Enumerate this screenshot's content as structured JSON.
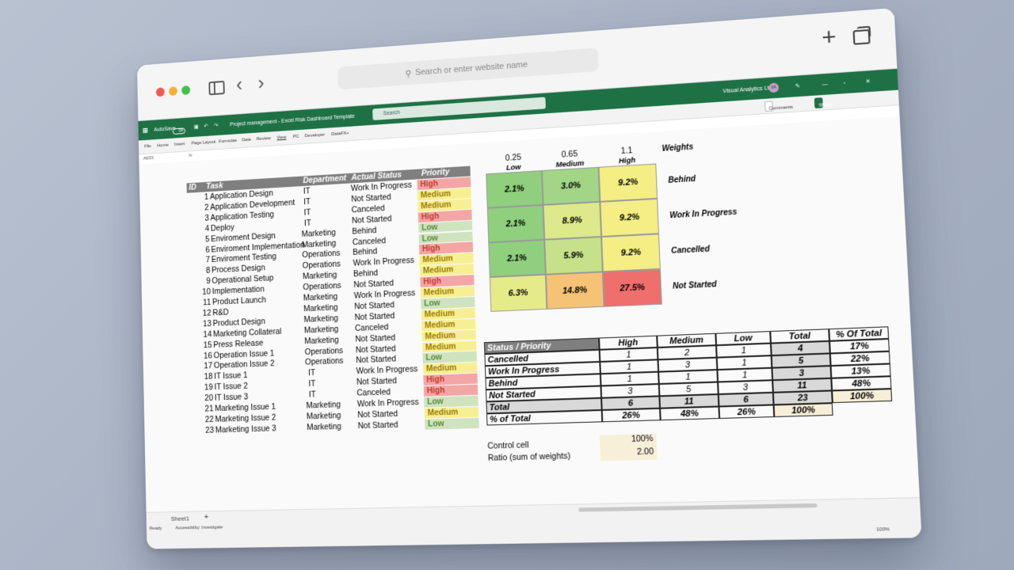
{
  "browser": {
    "search_placeholder": "Search or enter website name"
  },
  "excel": {
    "autosave_label": "AutoSave",
    "toggle_state": "Off",
    "file_title": "Project management - Excel Risk Dashboard Template",
    "search_placeholder": "Search",
    "account": "Visual Analytics Ltd",
    "account_initials": "VA",
    "ribbon_tabs": [
      "File",
      "Home",
      "Insert",
      "Page Layout",
      "Formulas",
      "Data",
      "Review",
      "View",
      "PC",
      "Developer",
      "DataFX+"
    ],
    "comments_label": "Comments",
    "share_label": "Share",
    "name_box": "AE53",
    "fx": "fx",
    "sheet_tab": "Sheet1",
    "status_ready": "Ready",
    "status_accessibility": "Accessibility: Investigate",
    "zoom": "100%"
  },
  "task_table": {
    "headers": [
      "ID",
      "Task",
      "Department",
      "Actual Status",
      "Priority"
    ],
    "rows": [
      {
        "id": "1",
        "task": "Application Design",
        "dept": "IT",
        "status": "Work In Progress",
        "priority": "High"
      },
      {
        "id": "2",
        "task": "Application Development",
        "dept": "IT",
        "status": "Not Started",
        "priority": "Medium"
      },
      {
        "id": "3",
        "task": "Application Testing",
        "dept": "IT",
        "status": "Canceled",
        "priority": "Medium"
      },
      {
        "id": "4",
        "task": "Deploy",
        "dept": "IT",
        "status": "Not Started",
        "priority": "High"
      },
      {
        "id": "5",
        "task": "Enviroment Design",
        "dept": "Marketing",
        "status": "Behind",
        "priority": "Low"
      },
      {
        "id": "6",
        "task": "Enviroment Implementation",
        "dept": "Marketing",
        "status": "Canceled",
        "priority": "Low"
      },
      {
        "id": "7",
        "task": "Enviroment Testing",
        "dept": "Operations",
        "status": "Behind",
        "priority": "High"
      },
      {
        "id": "8",
        "task": "Process Design",
        "dept": "Operations",
        "status": "Work In Progress",
        "priority": "Medium"
      },
      {
        "id": "9",
        "task": "Operational Setup",
        "dept": "Marketing",
        "status": "Behind",
        "priority": "Medium"
      },
      {
        "id": "10",
        "task": "Implementation",
        "dept": "Operations",
        "status": "Not Started",
        "priority": "High"
      },
      {
        "id": "11",
        "task": "Product Launch",
        "dept": "Marketing",
        "status": "Work In Progress",
        "priority": "Medium"
      },
      {
        "id": "12",
        "task": "R&D",
        "dept": "Marketing",
        "status": "Not Started",
        "priority": "Low"
      },
      {
        "id": "13",
        "task": "Product Design",
        "dept": "Marketing",
        "status": "Not Started",
        "priority": "Medium"
      },
      {
        "id": "14",
        "task": "Marketing Collateral",
        "dept": "Marketing",
        "status": "Canceled",
        "priority": "Medium"
      },
      {
        "id": "15",
        "task": "Press Release",
        "dept": "Marketing",
        "status": "Not Started",
        "priority": "Medium"
      },
      {
        "id": "16",
        "task": "Operation Issue 1",
        "dept": "Operations",
        "status": "Not Started",
        "priority": "Medium"
      },
      {
        "id": "17",
        "task": "Operation Issue 2",
        "dept": "Operations",
        "status": "Not Started",
        "priority": "Low"
      },
      {
        "id": "18",
        "task": "IT Issue 1",
        "dept": "IT",
        "status": "Work In Progress",
        "priority": "Medium"
      },
      {
        "id": "19",
        "task": "IT Issue 2",
        "dept": "IT",
        "status": "Not Started",
        "priority": "High"
      },
      {
        "id": "20",
        "task": "IT Issue 3",
        "dept": "IT",
        "status": "Canceled",
        "priority": "High"
      },
      {
        "id": "21",
        "task": "Marketing Issue 1",
        "dept": "Marketing",
        "status": "Work In Progress",
        "priority": "Low"
      },
      {
        "id": "22",
        "task": "Marketing Issue 2",
        "dept": "Marketing",
        "status": "Not Started",
        "priority": "Medium"
      },
      {
        "id": "23",
        "task": "Marketing Issue 3",
        "dept": "Marketing",
        "status": "Not Started",
        "priority": "Low"
      }
    ],
    "priority_colors": {
      "High": "#f4a6a6",
      "Medium": "#f7ef93",
      "Low": "#cfe3bf"
    }
  },
  "heatmap": {
    "weights": [
      "0.25",
      "0.65",
      "1.1"
    ],
    "weights_label": "Weights",
    "columns": [
      "Low",
      "Medium",
      "High"
    ],
    "rows": [
      {
        "label": "Behind",
        "cells": [
          {
            "v": "2.1%",
            "c": "#8fcf7d"
          },
          {
            "v": "3.0%",
            "c": "#a2d586"
          },
          {
            "v": "9.2%",
            "c": "#f4ee84"
          }
        ]
      },
      {
        "label": "Work In Progress",
        "cells": [
          {
            "v": "2.1%",
            "c": "#8fcf7d"
          },
          {
            "v": "8.9%",
            "c": "#dde98a"
          },
          {
            "v": "9.2%",
            "c": "#f4ee84"
          }
        ]
      },
      {
        "label": "Cancelled",
        "cells": [
          {
            "v": "2.1%",
            "c": "#8fcf7d"
          },
          {
            "v": "5.9%",
            "c": "#c6e18a"
          },
          {
            "v": "9.2%",
            "c": "#f4ee84"
          }
        ]
      },
      {
        "label": "Not Started",
        "cells": [
          {
            "v": "6.3%",
            "c": "#e6eb8a"
          },
          {
            "v": "14.8%",
            "c": "#f6c275"
          },
          {
            "v": "27.5%",
            "c": "#ef6f6c"
          }
        ]
      }
    ]
  },
  "summary": {
    "headers": [
      "Status / Priority",
      "High",
      "Medium",
      "Low",
      "Total",
      "% Of Total"
    ],
    "rows": [
      {
        "label": "Cancelled",
        "vals": [
          "1",
          "2",
          "1",
          "4",
          "17%"
        ]
      },
      {
        "label": "Work In Progress",
        "vals": [
          "1",
          "3",
          "1",
          "5",
          "22%"
        ]
      },
      {
        "label": "Behind",
        "vals": [
          "1",
          "1",
          "1",
          "3",
          "13%"
        ]
      },
      {
        "label": "Not Started",
        "vals": [
          "3",
          "5",
          "3",
          "11",
          "48%"
        ]
      },
      {
        "label": "Total",
        "vals": [
          "6",
          "11",
          "6",
          "23",
          "100%"
        ]
      }
    ],
    "pct_label": "% of Total",
    "pct_vals": [
      "26%",
      "48%",
      "26%",
      "100%"
    ]
  },
  "control": {
    "control_label": "Control cell",
    "control_value": "100%",
    "ratio_label": "Ratio (sum of weights)",
    "ratio_value": "2.00"
  }
}
